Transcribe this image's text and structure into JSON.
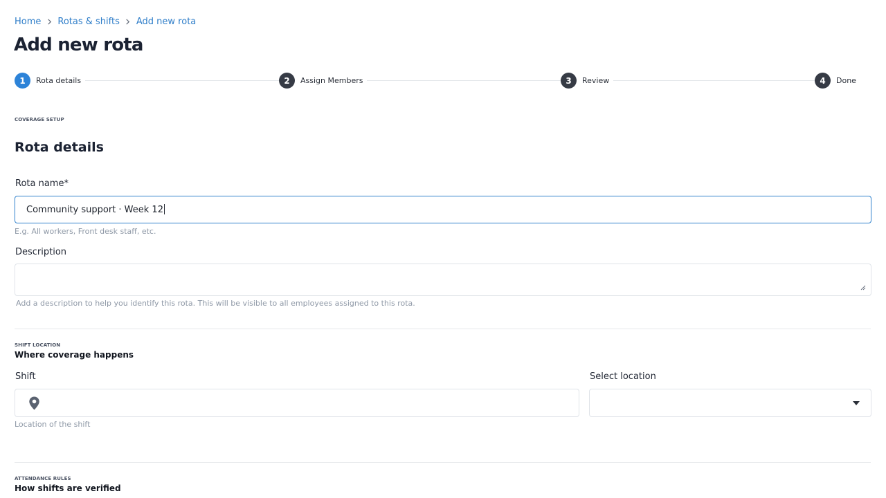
{
  "breadcrumb": {
    "items": [
      {
        "label": "Home"
      },
      {
        "label": "Rotas & shifts"
      },
      {
        "label": "Add new rota"
      }
    ]
  },
  "page": {
    "title": "Add new rota"
  },
  "stepper": {
    "steps": [
      {
        "number": "1",
        "label": "Rota details",
        "active": true
      },
      {
        "number": "2",
        "label": "Assign Members",
        "active": false
      },
      {
        "number": "3",
        "label": "Review",
        "active": false
      },
      {
        "number": "4",
        "label": "Done",
        "active": false
      }
    ],
    "colors": {
      "active": "#2d83d8",
      "inactive": "#363b45"
    }
  },
  "coverage": {
    "eyebrow": "COVERAGE SETUP",
    "title": "Rota details",
    "rota_name": {
      "label": "Rota name",
      "required_mark": "*",
      "value": "Community support · Week 12",
      "helper": "E.g. All workers, Front desk staff, etc."
    },
    "description": {
      "label": "Description",
      "value": "",
      "helper": "Add a description to help you identify this rota. This will be visible to all employees assigned to this rota."
    }
  },
  "shift_location": {
    "eyebrow": "SHIFT LOCATION",
    "subtitle": "Where coverage happens",
    "shift": {
      "label": "Shift",
      "value": "",
      "icon": "map-pin-icon",
      "helper": "Location of the shift"
    },
    "location": {
      "label": "Select location",
      "selected": "",
      "icon": "chevron-down-icon"
    }
  },
  "attendance": {
    "eyebrow": "ATTENDANCE RULES",
    "subtitle": "How shifts are verified"
  },
  "theme": {
    "accent": "#2d83d8",
    "link": "#2f7ec9",
    "focus_border": "#2e80cc"
  }
}
